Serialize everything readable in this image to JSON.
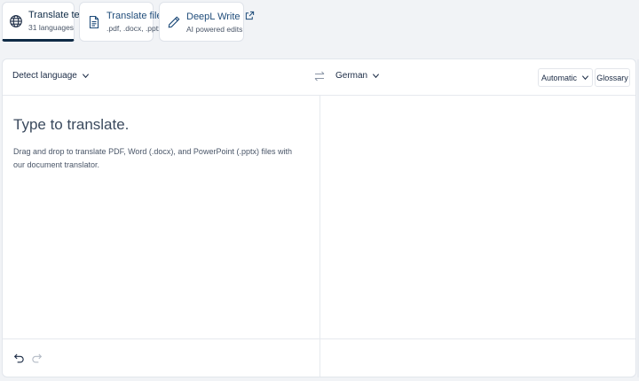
{
  "tabs": [
    {
      "label": "Translate text",
      "sub": "31 languages",
      "icon": "globe-icon",
      "active": true
    },
    {
      "label": "Translate files",
      "sub": ".pdf, .docx, .pptx",
      "icon": "document-icon",
      "active": false
    },
    {
      "label": "DeepL Write",
      "sub": "AI powered edits",
      "icon": "pen-icon",
      "active": false,
      "external": "external-link-icon"
    }
  ],
  "translator": {
    "source_language": "Detect language",
    "target_language": "German",
    "tone": "Automatic",
    "glossary": "Glossary",
    "placeholder": "Type to translate.",
    "hint": "Drag and drop to translate PDF, Word (.docx), and PowerPoint (.pptx) files with our document translator."
  },
  "colors": {
    "accent": "#0f2b46",
    "background": "#f1f3f6",
    "panel": "#ffffff"
  }
}
